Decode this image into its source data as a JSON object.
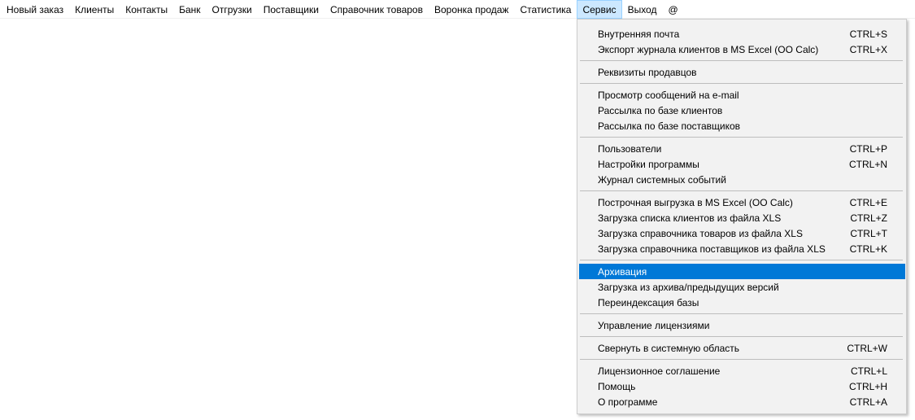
{
  "menubar": {
    "items": [
      {
        "label": "Новый заказ"
      },
      {
        "label": "Клиенты"
      },
      {
        "label": "Контакты"
      },
      {
        "label": "Банк"
      },
      {
        "label": "Отгрузки"
      },
      {
        "label": "Поставщики"
      },
      {
        "label": "Справочник товаров"
      },
      {
        "label": "Воронка продаж"
      },
      {
        "label": "Статистика"
      },
      {
        "label": "Сервис",
        "active": true
      },
      {
        "label": "Выход"
      },
      {
        "label": "@"
      }
    ]
  },
  "service_menu": {
    "groups": [
      [
        {
          "label": "Внутренняя почта",
          "shortcut": "CTRL+S"
        },
        {
          "label": "Экспорт журнала клиентов в MS Excel (OO Calc)",
          "shortcut": "CTRL+X"
        }
      ],
      [
        {
          "label": "Реквизиты продавцов",
          "shortcut": ""
        }
      ],
      [
        {
          "label": "Просмотр сообщений на e-mail",
          "shortcut": ""
        },
        {
          "label": "Рассылка по базе клиентов",
          "shortcut": ""
        },
        {
          "label": "Рассылка по базе поставщиков",
          "shortcut": ""
        }
      ],
      [
        {
          "label": "Пользователи",
          "shortcut": "CTRL+P"
        },
        {
          "label": "Настройки программы",
          "shortcut": "CTRL+N"
        },
        {
          "label": "Журнал системных событий",
          "shortcut": ""
        }
      ],
      [
        {
          "label": "Построчная выгрузка в MS Excel (OO Calc)",
          "shortcut": "CTRL+E"
        },
        {
          "label": "Загрузка списка клиентов из файла XLS",
          "shortcut": "CTRL+Z"
        },
        {
          "label": "Загрузка справочника товаров из файла XLS",
          "shortcut": "CTRL+T"
        },
        {
          "label": "Загрузка справочника поставщиков из файла XLS",
          "shortcut": "CTRL+K"
        }
      ],
      [
        {
          "label": "Архивация",
          "shortcut": "",
          "highlighted": true
        },
        {
          "label": "Загрузка из архива/предыдущих версий",
          "shortcut": ""
        },
        {
          "label": "Переиндексация базы",
          "shortcut": ""
        }
      ],
      [
        {
          "label": "Управление лицензиями",
          "shortcut": ""
        }
      ],
      [
        {
          "label": "Свернуть в системную область",
          "shortcut": "CTRL+W"
        }
      ],
      [
        {
          "label": "Лицензионное соглашение",
          "shortcut": "CTRL+L"
        },
        {
          "label": "Помощь",
          "shortcut": "CTRL+H"
        },
        {
          "label": "О программе",
          "shortcut": "CTRL+A"
        }
      ]
    ]
  }
}
